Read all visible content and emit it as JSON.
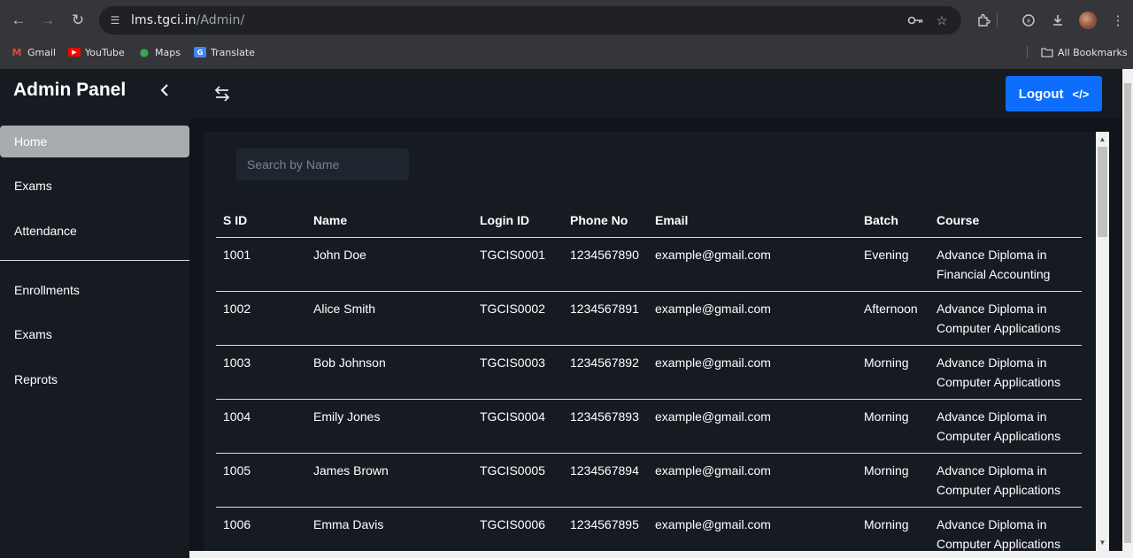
{
  "browser": {
    "url_host": "lms.tgci.in",
    "url_path": "/Admin/",
    "bookmarks": [
      {
        "label": "Gmail",
        "icon": "gmail-icon",
        "color": "#ea4335"
      },
      {
        "label": "YouTube",
        "icon": "youtube-icon",
        "color": "#ff0000"
      },
      {
        "label": "Maps",
        "icon": "maps-icon",
        "color": "#34a853"
      },
      {
        "label": "Translate",
        "icon": "translate-icon",
        "color": "#4285f4"
      }
    ],
    "all_bookmarks": "All Bookmarks"
  },
  "sidebar": {
    "title": "Admin Panel",
    "items": [
      {
        "label": "Home",
        "active": true
      },
      {
        "label": "Exams"
      },
      {
        "label": "Attendance"
      },
      {
        "label": "Enrollments"
      },
      {
        "label": "Exams"
      },
      {
        "label": "Reprots"
      }
    ]
  },
  "topbar": {
    "logout_label": "Logout",
    "logout_icon": "</>",
    "accent": "#0d6efd"
  },
  "search": {
    "placeholder": "Search by Name"
  },
  "table": {
    "columns": [
      "S ID",
      "Name",
      "Login ID",
      "Phone No",
      "Email",
      "Batch",
      "Course"
    ],
    "rows": [
      [
        "1001",
        "John Doe",
        "TGCIS0001",
        "1234567890",
        "example@gmail.com",
        "Evening",
        "Advance Diploma in",
        "Financial Accounting"
      ],
      [
        "1002",
        "Alice Smith",
        "TGCIS0002",
        "1234567891",
        "example@gmail.com",
        "Afternoon",
        "Advance Diploma in",
        "Computer Applications"
      ],
      [
        "1003",
        "Bob Johnson",
        "TGCIS0003",
        "1234567892",
        "example@gmail.com",
        "Morning",
        "Advance Diploma in",
        "Computer Applications"
      ],
      [
        "1004",
        "Emily Jones",
        "TGCIS0004",
        "1234567893",
        "example@gmail.com",
        "Morning",
        "Advance Diploma in",
        "Computer Applications"
      ],
      [
        "1005",
        "James Brown",
        "TGCIS0005",
        "1234567894",
        "example@gmail.com",
        "Morning",
        "Advance Diploma in",
        "Computer Applications"
      ],
      [
        "1006",
        "Emma Davis",
        "TGCIS0006",
        "1234567895",
        "example@gmail.com",
        "Morning",
        "Advance Diploma in",
        "Computer Applications"
      ]
    ]
  }
}
